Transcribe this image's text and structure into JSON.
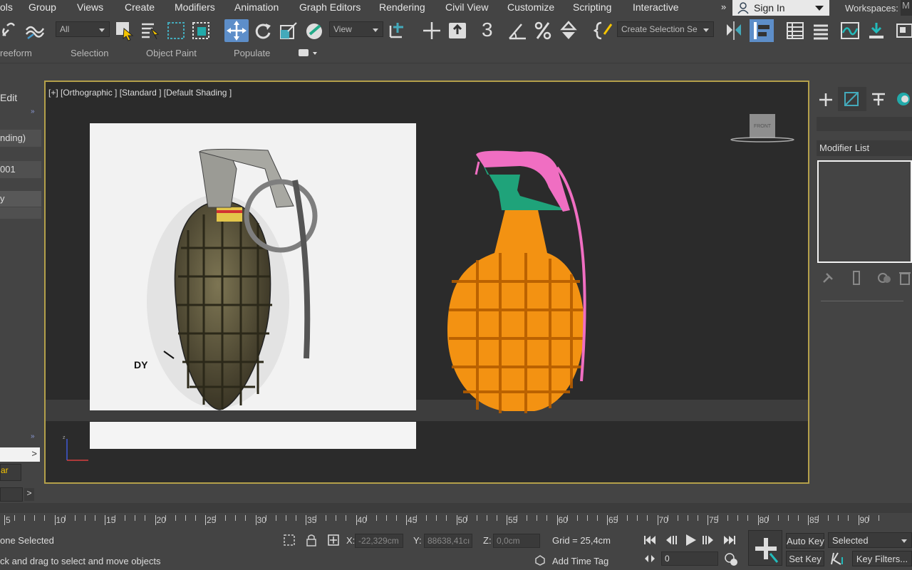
{
  "menubar": {
    "items": [
      "ols",
      "Group",
      "Views",
      "Create",
      "Modifiers",
      "Animation",
      "Graph Editors",
      "Rendering",
      "Civil View",
      "Customize",
      "Scripting",
      "Interactive"
    ],
    "overflow": "»",
    "signin": "Sign In",
    "workspaces": "Workspaces:",
    "workspace_value": "M"
  },
  "toolbar": {
    "filter_value": "All",
    "refcoord_value": "View",
    "selection_set": "Create Selection Se",
    "snap_label": "3",
    "icons": [
      "unlink-icon",
      "bind-spacewarp-icon",
      "select-icon",
      "select-by-name-icon",
      "rect-region-icon",
      "window-crossing-icon",
      "move-icon",
      "rotate-icon",
      "scale-icon",
      "place-icon",
      "select-manipulate-icon",
      "pivot-icon",
      "snaps-toggle-icon",
      "angle-snap-icon",
      "percent-snap-icon",
      "spinner-snap-icon",
      "edit-named-sel-icon",
      "mirror-icon",
      "align-icon",
      "scene-explorer-icon",
      "layer-explorer-icon",
      "curve-editor-icon",
      "schematic-icon",
      "material-editor-icon"
    ]
  },
  "ribbon": {
    "tabs": [
      "reeform",
      "Selection",
      "Object Paint",
      "Populate"
    ]
  },
  "left_panel": {
    "items": [
      "Edit",
      "nding)",
      "001",
      "y"
    ],
    "bottom_field": "ar",
    "arrow": ">"
  },
  "viewport": {
    "label": "[+] [Orthographic ] [Standard ] [Default Shading ]",
    "viewcube_label": "FRONT",
    "ref_annotation": "DY"
  },
  "command_panel": {
    "modifier_list": "Modifier List"
  },
  "timeline": {
    "frame_numbers": [
      5,
      10,
      15,
      20,
      25,
      30,
      35,
      40,
      45,
      50,
      55,
      60,
      65,
      70,
      75,
      80,
      85,
      90
    ],
    "scroll_arrow": ">"
  },
  "status": {
    "selection": "one Selected",
    "prompt": "ck and drag to select and move objects",
    "x_label": "X:",
    "x_value": "-22,329cm",
    "y_label": "Y:",
    "y_value": "88638,41cı",
    "z_label": "Z:",
    "z_value": "0,0cm",
    "grid": "Grid = 25,4cm",
    "add_time_tag": "Add Time Tag",
    "frame": "0",
    "auto_key": "Auto Key",
    "set_key": "Set Key",
    "key_mode": "Selected",
    "key_filters": "Key Filters..."
  },
  "colors": {
    "viewport_border": "#b4a04a",
    "grenade_body": "#f39212",
    "grenade_cap": "#1fa37a",
    "grenade_lever": "#f06ec2"
  }
}
